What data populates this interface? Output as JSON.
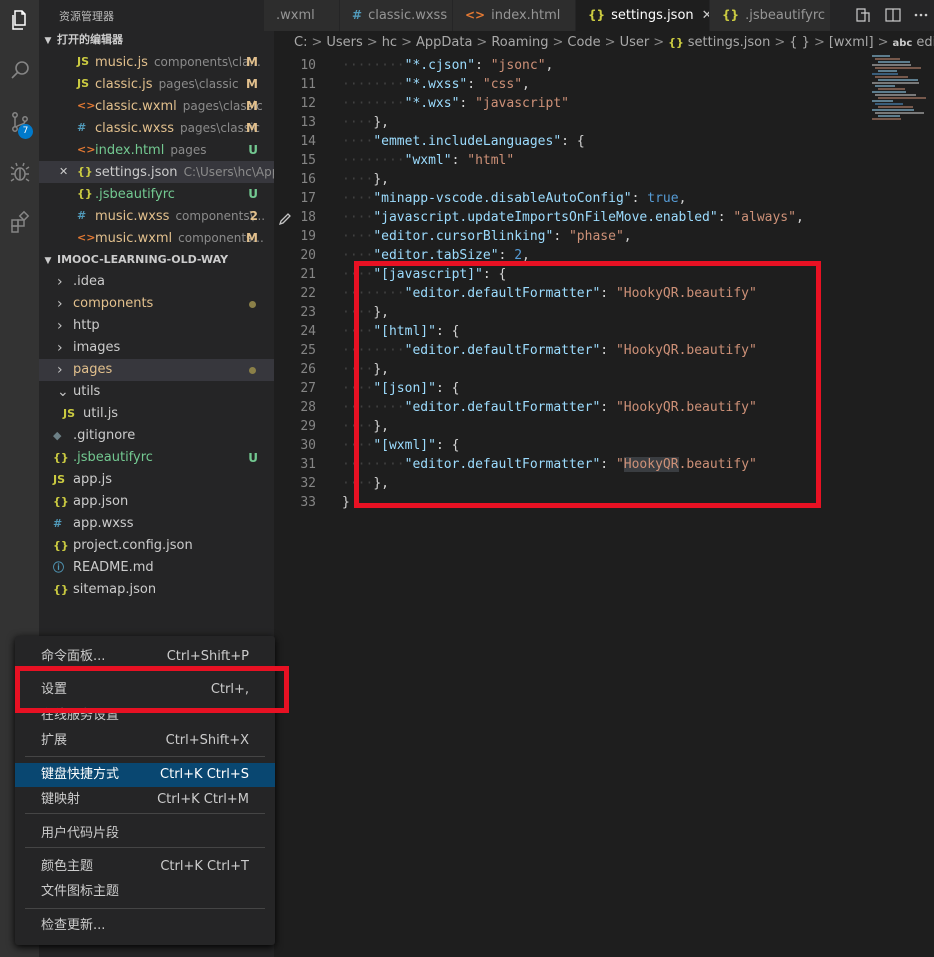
{
  "activity": {
    "scm_badge": "7"
  },
  "sidebar": {
    "title": "资源管理器",
    "open_editors_label": "打开的编辑器",
    "open_editors": [
      {
        "icon": "JS",
        "name": "music.js",
        "desc": "components\\cla...",
        "status": "M"
      },
      {
        "icon": "JS",
        "name": "classic.js",
        "desc": "pages\\classic",
        "status": "M"
      },
      {
        "icon": "<>",
        "name": "classic.wxml",
        "desc": "pages\\classic",
        "status": "M"
      },
      {
        "icon": "#",
        "name": "classic.wxss",
        "desc": "pages\\classic",
        "status": "M"
      },
      {
        "icon": "<>",
        "name": "index.html",
        "desc": "pages",
        "status": "U"
      },
      {
        "icon": "{}",
        "name": "settings.json",
        "desc": "C:\\Users\\hc\\App...",
        "status": "",
        "close": "✕"
      },
      {
        "icon": "{}",
        "name": ".jsbeautifyrc",
        "desc": "",
        "status": "U"
      },
      {
        "icon": "#",
        "name": "music.wxss",
        "desc": "components\\...",
        "status": "2"
      },
      {
        "icon": "<>",
        "name": "music.wxml",
        "desc": "components...",
        "status": "M"
      }
    ],
    "project_label": "IMOOC-LEARNING-OLD-WAY",
    "tree": [
      {
        "chev": "›",
        "icon": "",
        "name": ".idea",
        "status": ""
      },
      {
        "chev": "›",
        "icon": "",
        "name": "components",
        "status": "dot"
      },
      {
        "chev": "›",
        "icon": "",
        "name": "http",
        "status": ""
      },
      {
        "chev": "›",
        "icon": "",
        "name": "images",
        "status": ""
      },
      {
        "chev": "›",
        "icon": "",
        "name": "pages",
        "status": "dot"
      },
      {
        "chev": "⌄",
        "icon": "",
        "name": "utils",
        "status": ""
      },
      {
        "chev": "",
        "icon": "JS",
        "name": "util.js",
        "status": ""
      },
      {
        "chev": "",
        "icon": "◆",
        "name": ".gitignore",
        "status": ""
      },
      {
        "chev": "",
        "icon": "{}",
        "name": ".jsbeautifyrc",
        "status": "U"
      },
      {
        "chev": "",
        "icon": "JS",
        "name": "app.js",
        "status": ""
      },
      {
        "chev": "",
        "icon": "{}",
        "name": "app.json",
        "status": ""
      },
      {
        "chev": "",
        "icon": "#",
        "name": "app.wxss",
        "status": ""
      },
      {
        "chev": "",
        "icon": "{}",
        "name": "project.config.json",
        "status": ""
      },
      {
        "chev": "",
        "icon": "ⓘ",
        "name": "README.md",
        "status": ""
      },
      {
        "chev": "",
        "icon": "{}",
        "name": "sitemap.json",
        "status": ""
      }
    ]
  },
  "tabs": [
    {
      "icon": "",
      "label": ".wxml"
    },
    {
      "icon": "#",
      "label": "classic.wxss"
    },
    {
      "icon": "<>",
      "label": "index.html"
    },
    {
      "icon": "{}",
      "label": "settings.json",
      "close": "✕"
    },
    {
      "icon": "{}",
      "label": ".jsbeautifyrc"
    }
  ],
  "breadcrumb": [
    "C:",
    "Users",
    "hc",
    "AppData",
    "Roaming",
    "Code",
    "User",
    "settings.json",
    "{ }",
    "[wxml]",
    "editor.defaultFormatter"
  ],
  "breadcrumb_seps": [
    ">",
    ">",
    ">",
    ">",
    ">",
    ">",
    ">",
    ">",
    ">",
    ">"
  ],
  "breadcrumb_icons": [
    "{}",
    "abc"
  ],
  "editor": {
    "lines": [
      {
        "n": "10",
        "t": "        \"*.cjson\": \"jsonc\","
      },
      {
        "n": "11",
        "t": "        \"*.wxss\": \"css\","
      },
      {
        "n": "12",
        "t": "        \"*.wxs\": \"javascript\""
      },
      {
        "n": "13",
        "t": "    },"
      },
      {
        "n": "14",
        "t": "    \"emmet.includeLanguages\": {"
      },
      {
        "n": "15",
        "t": "        \"wxml\": \"html\""
      },
      {
        "n": "16",
        "t": "    },"
      },
      {
        "n": "17",
        "t": "    \"minapp-vscode.disableAutoConfig\": true,"
      },
      {
        "n": "18",
        "t": "    \"javascript.updateImportsOnFileMove.enabled\": \"always\","
      },
      {
        "n": "19",
        "t": "    \"editor.cursorBlinking\": \"phase\","
      },
      {
        "n": "20",
        "t": "    \"editor.tabSize\": 2,"
      },
      {
        "n": "21",
        "t": "    \"[javascript]\": {"
      },
      {
        "n": "22",
        "t": "        \"editor.defaultFormatter\": \"HookyQR.beautify\""
      },
      {
        "n": "23",
        "t": "    },"
      },
      {
        "n": "24",
        "t": "    \"[html]\": {"
      },
      {
        "n": "25",
        "t": "        \"editor.defaultFormatter\": \"HookyQR.beautify\""
      },
      {
        "n": "26",
        "t": "    },"
      },
      {
        "n": "27",
        "t": "    \"[json]\": {"
      },
      {
        "n": "28",
        "t": "        \"editor.defaultFormatter\": \"HookyQR.beautify\""
      },
      {
        "n": "29",
        "t": "    },"
      },
      {
        "n": "30",
        "t": "    \"[wxml]\": {"
      },
      {
        "n": "31",
        "t": "        \"editor.defaultFormatter\": \"HookyQR.beautify\""
      },
      {
        "n": "32",
        "t": "    },"
      },
      {
        "n": "33",
        "t": "}"
      }
    ]
  },
  "menu": {
    "items": [
      {
        "label": "命令面板...",
        "key": "Ctrl+Shift+P"
      },
      {
        "label": "设置",
        "key": "Ctrl+,"
      },
      {
        "label": "在线服务设置",
        "key": ""
      },
      {
        "label": "扩展",
        "key": "Ctrl+Shift+X"
      },
      {
        "label": "键盘快捷方式",
        "key": "Ctrl+K Ctrl+S",
        "highlight": true
      },
      {
        "label": "键映射",
        "key": "Ctrl+K Ctrl+M"
      },
      {
        "label": "用户代码片段",
        "key": ""
      },
      {
        "label": "颜色主题",
        "key": "Ctrl+K Ctrl+T"
      },
      {
        "label": "文件图标主题",
        "key": ""
      },
      {
        "label": "检查更新...",
        "key": ""
      }
    ]
  },
  "colors": {
    "accent": "#007acc",
    "annotation": "#e81123",
    "menu_highlight": "#094771"
  }
}
